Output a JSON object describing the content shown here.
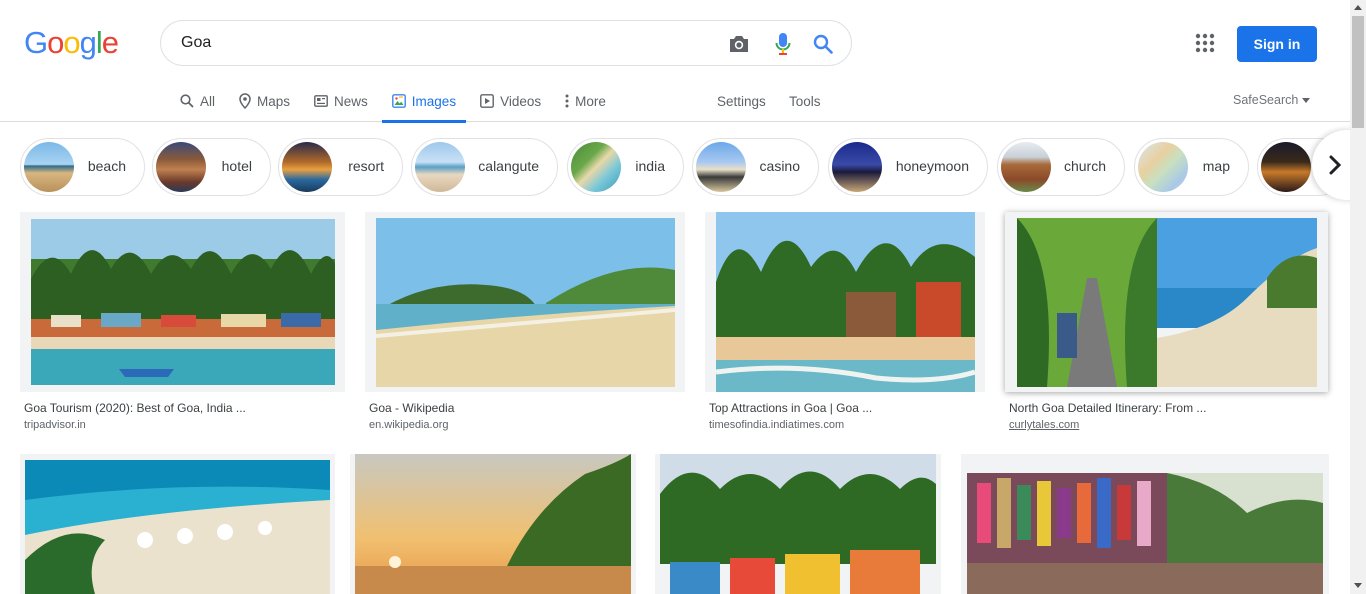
{
  "logo": [
    "G",
    "o",
    "o",
    "g",
    "l",
    "e"
  ],
  "logo_colors": [
    "#4285f4",
    "#ea4335",
    "#fbbc05",
    "#4285f4",
    "#34a853",
    "#ea4335"
  ],
  "search": {
    "value": "Goa"
  },
  "header": {
    "signin_label": "Sign in"
  },
  "tabs": [
    {
      "label": "All",
      "icon": "search-icon"
    },
    {
      "label": "Maps",
      "icon": "map-pin-icon"
    },
    {
      "label": "News",
      "icon": "news-icon"
    },
    {
      "label": "Images",
      "icon": "image-icon",
      "active": true
    },
    {
      "label": "Videos",
      "icon": "play-icon"
    },
    {
      "label": "More",
      "icon": "more-vertical-icon"
    }
  ],
  "tools": {
    "settings": "Settings",
    "tools": "Tools",
    "safesearch": "SafeSearch"
  },
  "chips": [
    {
      "label": "beach"
    },
    {
      "label": "hotel"
    },
    {
      "label": "resort"
    },
    {
      "label": "calangute"
    },
    {
      "label": "india"
    },
    {
      "label": "casino"
    },
    {
      "label": "honeymoon"
    },
    {
      "label": "church"
    },
    {
      "label": "map"
    },
    {
      "label": ""
    }
  ],
  "results": [
    {
      "title": "Goa Tourism (2020): Best of Goa, India ...",
      "source": "tripadvisor.in"
    },
    {
      "title": "Goa - Wikipedia",
      "source": "en.wikipedia.org"
    },
    {
      "title": "Top Attractions in Goa | Goa ...",
      "source": "timesofindia.indiatimes.com"
    },
    {
      "title": "North Goa Detailed Itinerary: From ...",
      "source": "curlytales.com"
    },
    {
      "title": "",
      "source": ""
    },
    {
      "title": "",
      "source": ""
    },
    {
      "title": "",
      "source": ""
    },
    {
      "title": "",
      "source": ""
    }
  ],
  "colors": {
    "accent": "#1a73e8",
    "border": "#dfe1e5",
    "muted": "#5f6368"
  }
}
